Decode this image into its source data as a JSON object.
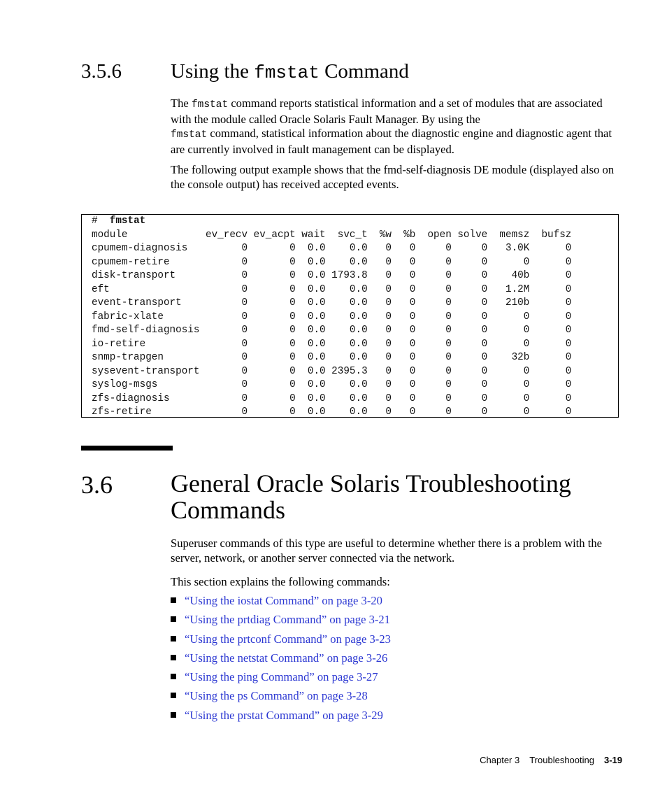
{
  "section_356": {
    "number": "3.5.6",
    "title_prefix": "Using the ",
    "title_code": "fmstat",
    "title_suffix": " Command",
    "para1": {
      "pre": "The ",
      "code1": "fmstat",
      "mid1": " command reports statistical information and a set of modules that are associated with the module called Oracle Solaris Fault Manager. By using the ",
      "code2": "fmstat",
      "post": " command, statistical information about the diagnostic engine and diagnostic agent that are currently involved in fault management can be displayed."
    },
    "para2": "The following output example shows that the fmd-self-diagnosis DE module (displayed also on the console output) has received accepted events."
  },
  "code_example": {
    "prompt": "#",
    "command": "fmstat",
    "columns": [
      "module",
      "ev_recv",
      "ev_acpt",
      "wait",
      "svc_t",
      "%w",
      "%b",
      "open",
      "solve",
      "memsz",
      "bufsz"
    ],
    "rows": [
      [
        "cpumem-diagnosis",
        "0",
        "0",
        "0.0",
        "0.0",
        "0",
        "0",
        "0",
        "0",
        "3.0K",
        "0"
      ],
      [
        "cpumem-retire",
        "0",
        "0",
        "0.0",
        "0.0",
        "0",
        "0",
        "0",
        "0",
        "0",
        "0"
      ],
      [
        "disk-transport",
        "0",
        "0",
        "0.0",
        "1793.8",
        "0",
        "0",
        "0",
        "0",
        "40b",
        "0"
      ],
      [
        "eft",
        "0",
        "0",
        "0.0",
        "0.0",
        "0",
        "0",
        "0",
        "0",
        "1.2M",
        "0"
      ],
      [
        "event-transport",
        "0",
        "0",
        "0.0",
        "0.0",
        "0",
        "0",
        "0",
        "0",
        "210b",
        "0"
      ],
      [
        "fabric-xlate",
        "0",
        "0",
        "0.0",
        "0.0",
        "0",
        "0",
        "0",
        "0",
        "0",
        "0"
      ],
      [
        "fmd-self-diagnosis",
        "0",
        "0",
        "0.0",
        "0.0",
        "0",
        "0",
        "0",
        "0",
        "0",
        "0"
      ],
      [
        "io-retire",
        "0",
        "0",
        "0.0",
        "0.0",
        "0",
        "0",
        "0",
        "0",
        "0",
        "0"
      ],
      [
        "snmp-trapgen",
        "0",
        "0",
        "0.0",
        "0.0",
        "0",
        "0",
        "0",
        "0",
        "32b",
        "0"
      ],
      [
        "sysevent-transport",
        "0",
        "0",
        "0.0",
        "2395.3",
        "0",
        "0",
        "0",
        "0",
        "0",
        "0"
      ],
      [
        "syslog-msgs",
        "0",
        "0",
        "0.0",
        "0.0",
        "0",
        "0",
        "0",
        "0",
        "0",
        "0"
      ],
      [
        "zfs-diagnosis",
        "0",
        "0",
        "0.0",
        "0.0",
        "0",
        "0",
        "0",
        "0",
        "0",
        "0"
      ],
      [
        "zfs-retire",
        "0",
        "0",
        "0.0",
        "0.0",
        "0",
        "0",
        "0",
        "0",
        "0",
        "0"
      ]
    ]
  },
  "section_36": {
    "number": "3.6",
    "title": "General Oracle Solaris Troubleshooting Commands",
    "para1": "Superuser commands of this type are useful to determine whether there is a problem with the server, network, or another server connected via the network.",
    "para2": "This section explains the following commands:",
    "links": [
      "“Using the iostat Command” on page 3-20",
      "“Using the prtdiag Command” on page 3-21",
      "“Using the prtconf Command” on page 3-23",
      "“Using the netstat Command” on page 3-26",
      "“Using the ping Command” on page 3-27",
      "“Using the ps Command” on page 3-28",
      "“Using the prstat Command” on page 3-29"
    ]
  },
  "footer": {
    "chapter": "Chapter 3",
    "chapter_title": "Troubleshooting",
    "page_number": "3-19"
  },
  "colors": {
    "link": "#2b37d2",
    "text": "#000000"
  }
}
